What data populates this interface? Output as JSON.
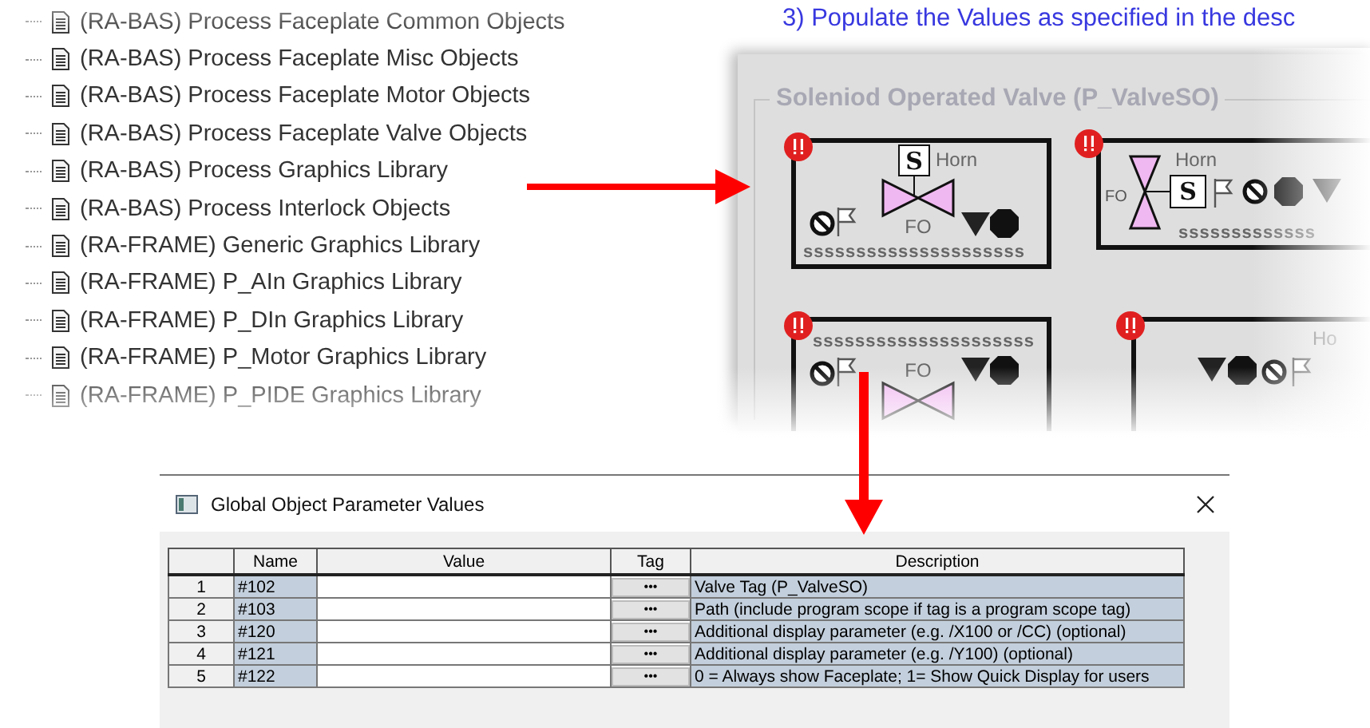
{
  "tree": {
    "items": [
      "(RA-BAS) Process Faceplate Common Objects",
      "(RA-BAS) Process Faceplate Misc Objects",
      "(RA-BAS) Process Faceplate Motor Objects",
      "(RA-BAS) Process Faceplate Valve Objects",
      "(RA-BAS) Process Graphics Library",
      "(RA-BAS) Process Interlock Objects",
      "(RA-FRAME) Generic Graphics Library",
      "(RA-FRAME) P_AIn Graphics Library",
      "(RA-FRAME) P_DIn Graphics Library",
      "(RA-FRAME) P_Motor Graphics Library",
      "(RA-FRAME) P_PIDE Graphics Library"
    ]
  },
  "instructions": {
    "line": "3)  Populate the Values as specified in the desc"
  },
  "faceplate_group": {
    "title": "Soleniod Operated Valve (P_ValveSO)",
    "faceplates": [
      {
        "kind": "valve-center",
        "solenoid": "S",
        "horn": "Horn",
        "fail_mode": "FO",
        "tag": "sssssssssssssssssssss"
      },
      {
        "kind": "valve-left",
        "solenoid": "S",
        "horn": "Horn",
        "fail_mode": "FO",
        "tag": "sssssssssssss"
      },
      {
        "kind": "tag-top",
        "fail_mode": "FO",
        "tag": "sssssssssssssssssssss"
      },
      {
        "kind": "icons-only",
        "horn": "Ho"
      }
    ]
  },
  "dialog": {
    "title": "Global Object Parameter Values",
    "columns": [
      "Name",
      "Value",
      "Tag",
      "Description"
    ],
    "rows": [
      {
        "index": "1",
        "name": "#102",
        "tag_button": "•••",
        "description": "Valve Tag (P_ValveSO)"
      },
      {
        "index": "2",
        "name": "#103",
        "tag_button": "•••",
        "description": "Path (include program scope if tag is a program scope tag)"
      },
      {
        "index": "3",
        "name": "#120",
        "tag_button": "•••",
        "description": "Additional display parameter (e.g. /X100 or /CC) (optional)"
      },
      {
        "index": "4",
        "name": "#121",
        "tag_button": "•••",
        "description": "Additional display parameter (e.g. /Y100) (optional)"
      },
      {
        "index": "5",
        "name": "#122",
        "tag_button": "•••",
        "description": "0 = Always show Faceplate;  1= Show Quick Display for users"
      }
    ]
  }
}
